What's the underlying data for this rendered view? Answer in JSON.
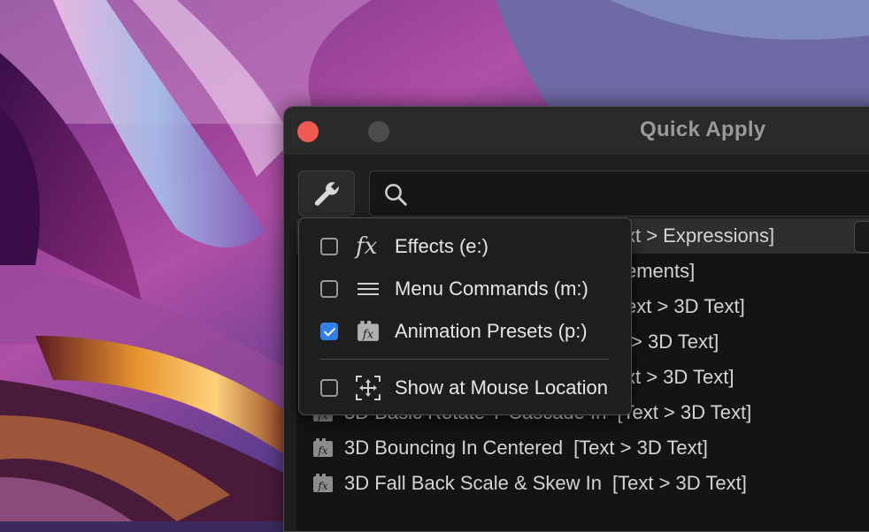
{
  "window": {
    "title": "Quick Apply"
  },
  "search": {
    "value": "",
    "placeholder": ""
  },
  "filter_menu": {
    "items": [
      {
        "label": "Effects (e:)",
        "checked": false,
        "icon": "fx-icon"
      },
      {
        "label": "Menu Commands (m:)",
        "checked": false,
        "icon": "menu-lines-icon"
      },
      {
        "label": "Animation Presets (p:)",
        "checked": true,
        "icon": "animation-preset-icon"
      },
      {
        "label": "Show at Mouse Location",
        "checked": false,
        "icon": "mouse-location-icon"
      }
    ]
  },
  "results": [
    {
      "name": "",
      "category": "xt > Expressions]"
    },
    {
      "name": "",
      "category": "ements]"
    },
    {
      "name": "",
      "category": "ext > 3D Text]"
    },
    {
      "name": "",
      "category": "> 3D Text]"
    },
    {
      "name": "",
      "category": "xt > 3D Text]"
    },
    {
      "name": "3D Basic Rotate Y Cascade In",
      "category": "[Text > 3D Text]"
    },
    {
      "name": "3D Bouncing In Centered",
      "category": "[Text > 3D Text]"
    },
    {
      "name": "3D Fall Back Scale & Skew In",
      "category": "[Text > 3D Text]"
    }
  ],
  "colors": {
    "accent": "#2f7fe8",
    "close": "#ed5a51",
    "window_bg": "#1f1f1f"
  }
}
